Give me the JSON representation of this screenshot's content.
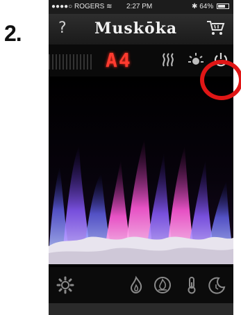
{
  "step": {
    "number": "2."
  },
  "status_bar": {
    "carrier": "●●●●○ ROGERS",
    "time": "2:27 PM",
    "battery": "64%"
  },
  "header": {
    "help_label": "?",
    "brand": "Muskōka"
  },
  "controls": {
    "display_readout": "A4"
  },
  "colors": {
    "display_red": "#ff3b2f",
    "highlight_red": "#e01616",
    "flame_purple": "#8a5cff",
    "flame_pink": "#ff5ad8"
  },
  "icons": {
    "help": "question-mark-icon",
    "cart": "cart-icon",
    "heat": "heat-waves-icon",
    "light": "light-icon",
    "power": "power-icon",
    "settings": "gear-icon",
    "flame": "flame-icon",
    "ember": "ember-bed-icon",
    "temperature": "thermometer-icon",
    "sleep": "moon-timer-icon"
  }
}
